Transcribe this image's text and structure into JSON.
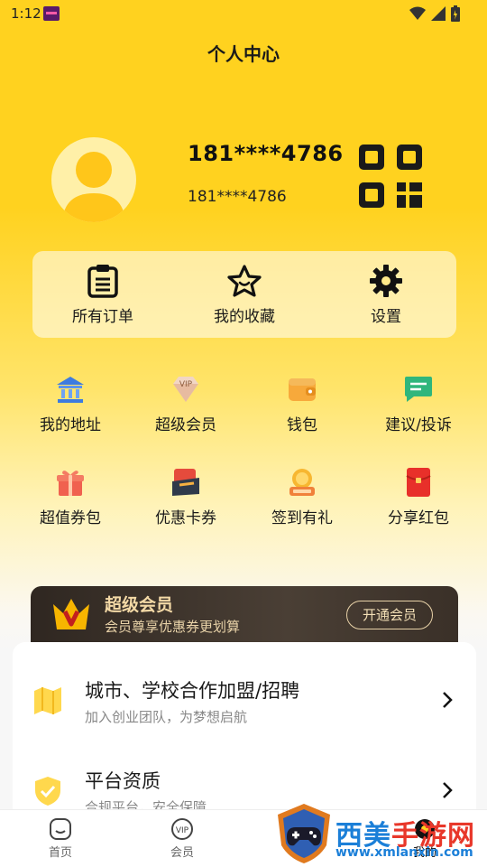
{
  "status_bar": {
    "time": "1:12"
  },
  "header": {
    "title": "个人中心"
  },
  "profile": {
    "name": "181****4786",
    "phone": "181****4786"
  },
  "quick_actions": [
    {
      "label": "所有订单",
      "icon": "order-list-icon"
    },
    {
      "label": "我的收藏",
      "icon": "star-icon"
    },
    {
      "label": "设置",
      "icon": "gear-icon"
    }
  ],
  "grid": [
    {
      "label": "我的地址",
      "icon": "bank-building-icon"
    },
    {
      "label": "超级会员",
      "icon": "vip-diamond-icon"
    },
    {
      "label": "钱包",
      "icon": "wallet-icon"
    },
    {
      "label": "建议/投诉",
      "icon": "chat-bubble-icon"
    },
    {
      "label": "超值券包",
      "icon": "gift-box-icon"
    },
    {
      "label": "优惠卡券",
      "icon": "coupon-icon"
    },
    {
      "label": "签到有礼",
      "icon": "checkin-coin-icon"
    },
    {
      "label": "分享红包",
      "icon": "red-envelope-icon"
    }
  ],
  "vip_banner": {
    "title": "超级会员",
    "subtitle": "会员尊享优惠券更划算",
    "button": "开通会员"
  },
  "list": [
    {
      "title": "城市、学校合作加盟/招聘",
      "subtitle": "加入创业团队，为梦想启航",
      "icon": "map-icon"
    },
    {
      "title": "平台资质",
      "subtitle": "合规平台，安全保障",
      "icon": "shield-icon"
    }
  ],
  "tabbar": [
    {
      "label": "首页",
      "icon": "home-icon"
    },
    {
      "label": "会员",
      "icon": "vip-tab-icon"
    },
    {
      "label": "我的",
      "icon": "user-tab-icon"
    }
  ],
  "watermark": {
    "text_a": "西美",
    "text_b": "手游网",
    "url": "www.xmlanxin.com"
  },
  "colors": {
    "accent": "#FFD21F",
    "vip_dark": "#2f2721",
    "vip_gold": "#F3D9A6"
  }
}
